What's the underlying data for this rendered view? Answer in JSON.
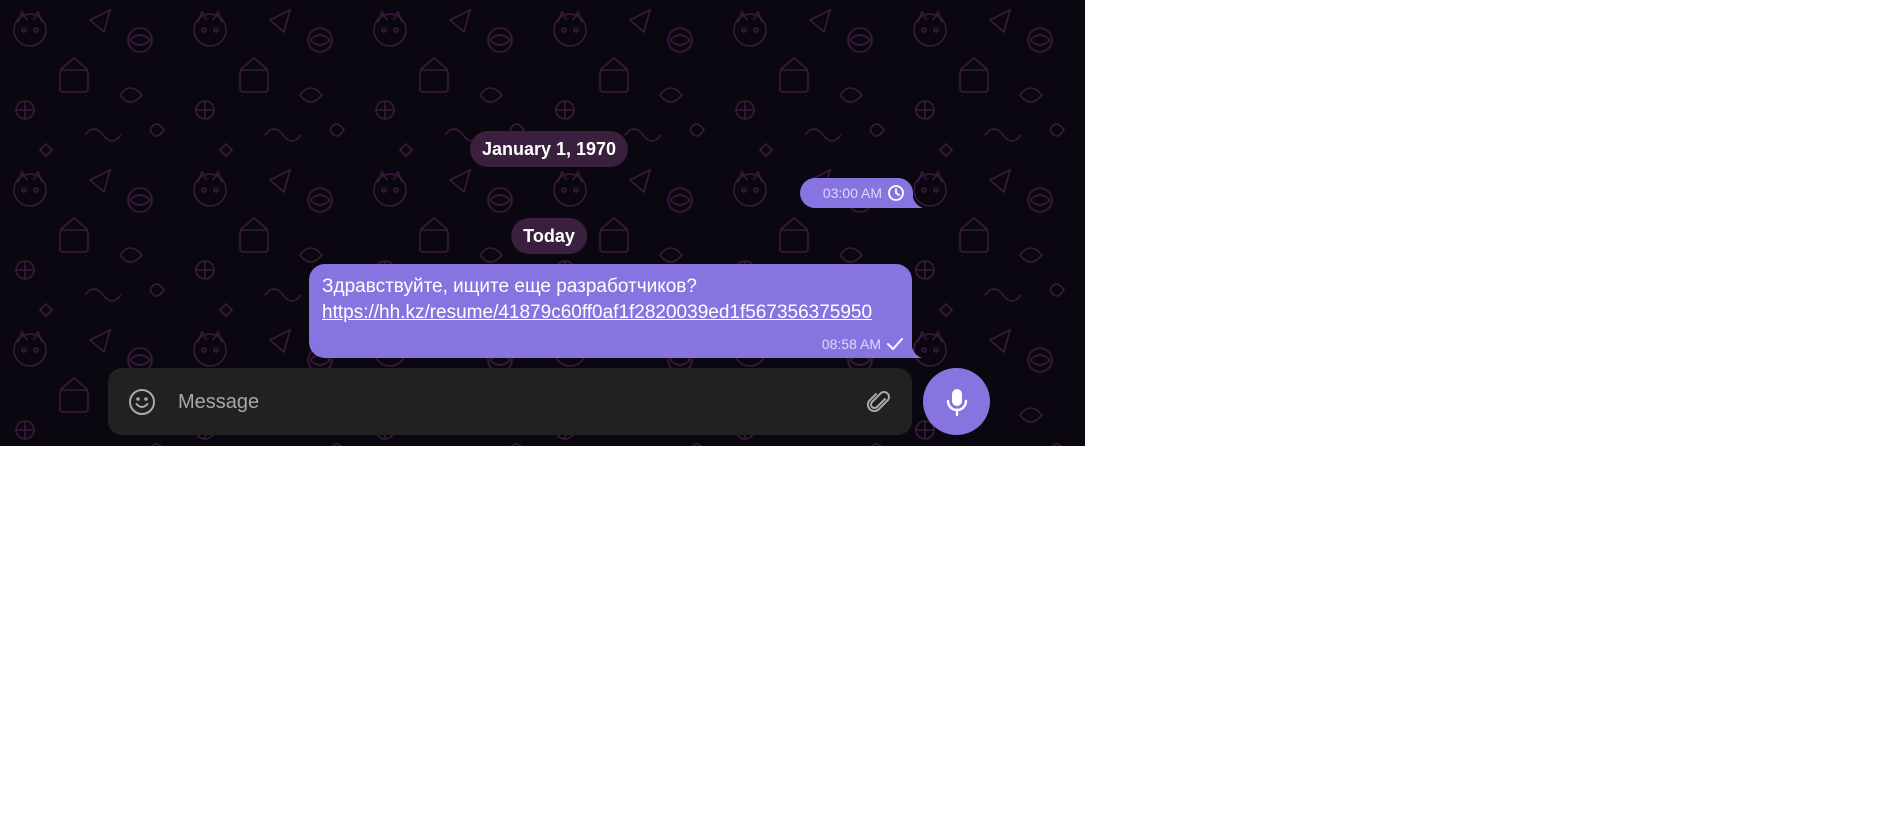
{
  "date_separators": {
    "first": "January 1, 1970",
    "second": "Today"
  },
  "messages": [
    {
      "time": "03:00 AM",
      "status_icon": "clock-icon",
      "text": "",
      "link": ""
    },
    {
      "time": "08:58 AM",
      "status_icon": "single-check-icon",
      "text": "Здравствуйте, ищите еще разработчиков?",
      "link": "https://hh.kz/resume/41879c60ff0af1f2820039ed1f567356375950"
    }
  ],
  "composer": {
    "placeholder": "Message",
    "value": "",
    "emoji_icon": "smile-icon",
    "attach_icon": "paperclip-icon"
  },
  "send_button": {
    "icon": "microphone-icon"
  },
  "colors": {
    "background": "#0b0710",
    "bubble_outgoing": "#8774e1",
    "date_pill": "#3a1f3e",
    "composer": "#212121",
    "accent": "#8774e1"
  }
}
